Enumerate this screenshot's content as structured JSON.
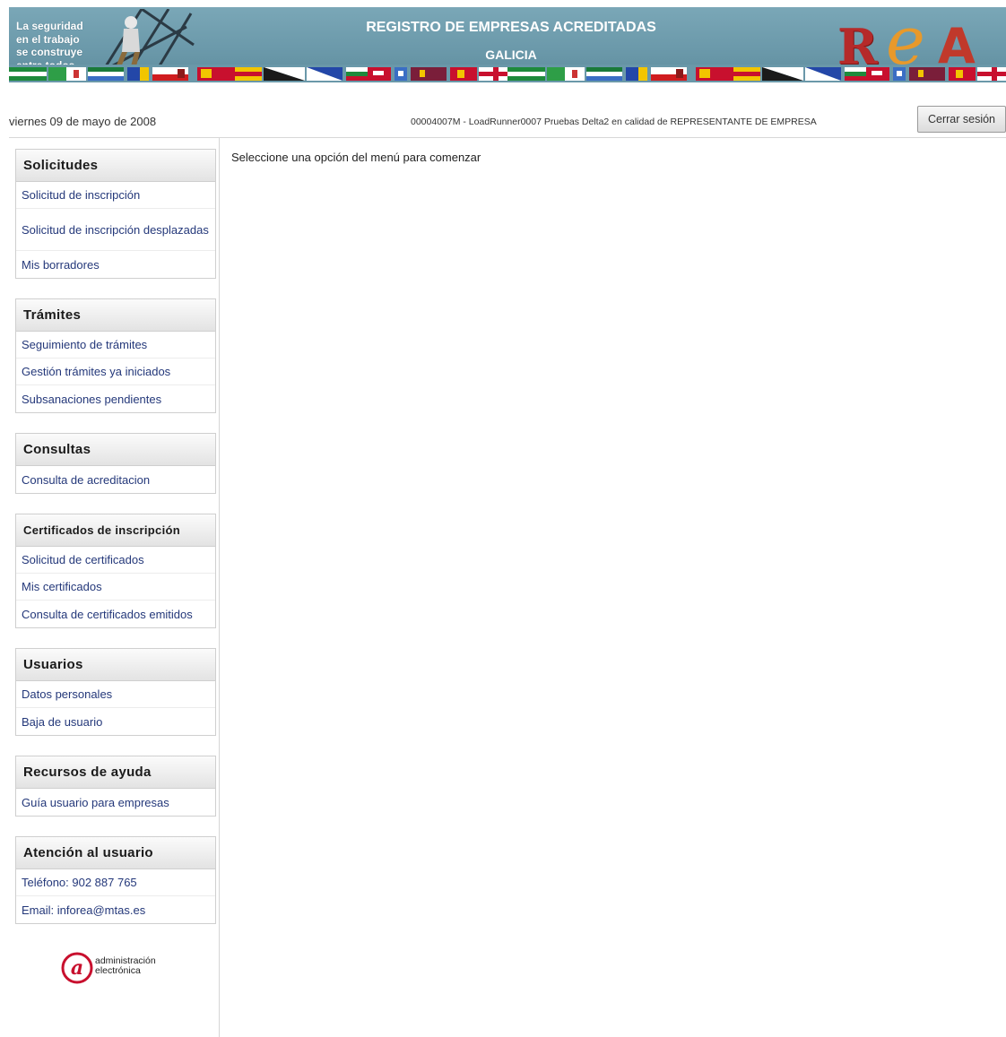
{
  "header": {
    "slogan": [
      "La seguridad",
      "en el trabajo",
      "se construye",
      "entre todos."
    ],
    "title": "REGISTRO DE EMPRESAS ACREDITADAS",
    "region": "GALICIA",
    "logo": "REA"
  },
  "infobar": {
    "date": "viernes 09 de mayo de 2008",
    "user": "00004007M - LoadRunner0007 Pruebas Delta2 en calidad de REPRESENTANTE DE EMPRESA",
    "logout_label": "Cerrar sesión"
  },
  "sidebar": {
    "solicitudes": {
      "title": "Solicitudes",
      "items": [
        "Solicitud de inscripción",
        "Solicitud de inscripción desplazadas",
        "Mis borradores"
      ]
    },
    "tramites": {
      "title": "Trámites",
      "items": [
        "Seguimiento de trámites",
        "Gestión trámites ya iniciados",
        "Subsanaciones pendientes"
      ]
    },
    "consultas": {
      "title": "Consultas",
      "items": [
        "Consulta de acreditacion"
      ]
    },
    "certificados": {
      "title": "Certificados de inscripción",
      "items": [
        "Solicitud de certificados",
        "Mis certificados",
        "Consulta de certificados emitidos"
      ]
    },
    "usuarios": {
      "title": "Usuarios",
      "items": [
        "Datos personales",
        "Baja de usuario"
      ]
    },
    "ayuda": {
      "title": "Recursos de ayuda",
      "items": [
        "Guía usuario para empresas"
      ]
    },
    "atencion": {
      "title": "Atención al usuario",
      "items": [
        "Teléfono: 902 887 765",
        "Email: inforea@mtas.es"
      ]
    },
    "footer_logo": [
      "administración",
      "electrónica"
    ]
  },
  "main": {
    "message": "Seleccione una opción del menú para comenzar"
  },
  "colors": {
    "banner": "#6a98a9",
    "link": "#24387a",
    "logo_r": "#b52a2a",
    "logo_e": "#e8992b"
  }
}
